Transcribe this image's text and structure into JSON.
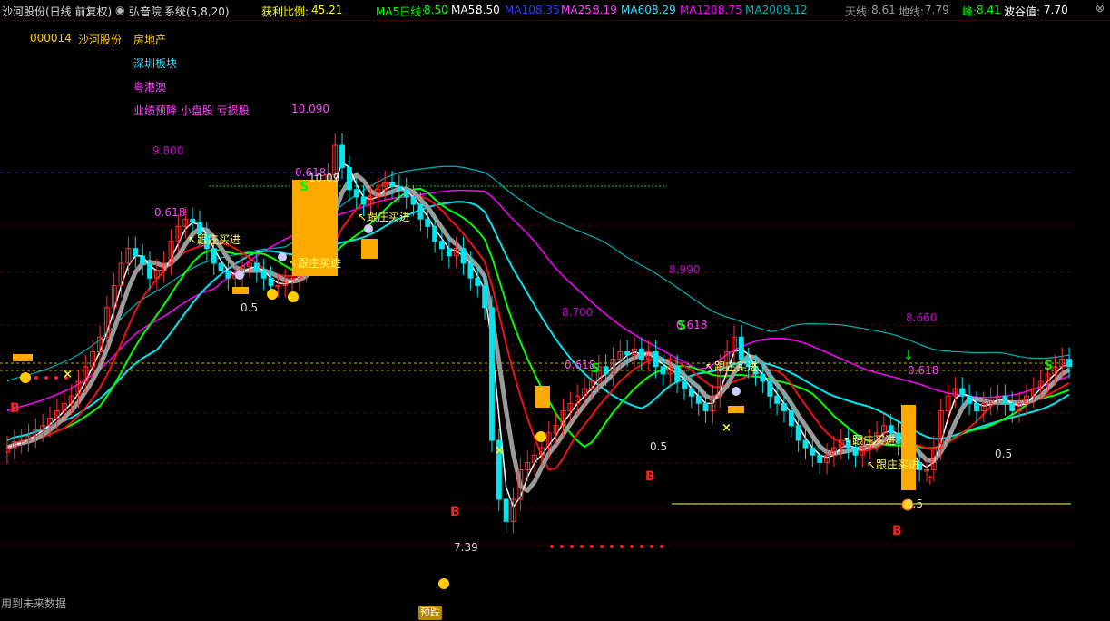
{
  "header": {
    "title": "沙河股份(日线 前复权)",
    "indicator_label": "弘音院",
    "system": "系统(5,8,20)",
    "profit_ratio_label": "获利比例:",
    "profit_ratio_value": "45.21",
    "ma5_day_label": "MA5日线:",
    "ma5_day_value": "8.50",
    "ma5_label": "MA5:",
    "ma5_value": "8.50",
    "ma10_label": "MA10:",
    "ma10_value": "8.35",
    "ma25_label": "MA25:",
    "ma25_value": "8.19",
    "ma60_label": "MA60:",
    "ma60_value": "8.29",
    "ma120_label": "MA120:",
    "ma120_value": "8.75",
    "ma200_label": "MA200:",
    "ma200_value": "9.12",
    "sky_label": "天线:",
    "sky_value": "8.61",
    "ground_label": "地线:",
    "ground_value": "7.79",
    "peak_label": "峰:",
    "peak_value": "8.41",
    "wave_label": "波谷值:",
    "wave_value": "7.70"
  },
  "info": {
    "code": "000014",
    "name": "沙河股份",
    "industry": "房地产",
    "board": "深圳板块",
    "concept": "粤港澳",
    "tags": "业绩预降 小盘股 亏损股",
    "price_level": "10.090"
  },
  "footer": {
    "future_data_note": "用到未来数据",
    "predict_drop": "预跌"
  },
  "colors": {
    "up": "#ff3030",
    "down": "#00e5ee",
    "ma5": "#ffffff",
    "ma10": "#1a3cff",
    "ma25": "#ff40ff",
    "ma60": "#00ff00",
    "ma120": "#ff00ff",
    "ma200": "#00b3b3"
  },
  "chart_data": {
    "type": "candlestick",
    "ylim": [
      7.2,
      10.4
    ],
    "level_labels": [
      {
        "text": "9.800",
        "price": 9.8,
        "color": "#cc00cc"
      },
      {
        "text": "8.990",
        "price": 9.0,
        "color": "#cc00cc"
      },
      {
        "text": "8.700",
        "price": 8.7,
        "color": "#cc00cc"
      },
      {
        "text": "8.660",
        "price": 8.66,
        "color": "#cc00cc"
      }
    ],
    "fib_labels": [
      {
        "text": "0.618",
        "color": "#ff44ff"
      },
      {
        "text": "0.618",
        "color": "#ff44ff"
      },
      {
        "text": "0.618",
        "color": "#ff44ff"
      },
      {
        "text": "0.618",
        "color": "#ff44ff"
      },
      {
        "text": "0.618",
        "color": "#ff44ff"
      },
      {
        "text": "0.5",
        "color": "#dddddd"
      },
      {
        "text": "0.5",
        "color": "#dddddd"
      },
      {
        "text": "0.5",
        "color": "#dddddd"
      },
      {
        "text": "0.5",
        "color": "#dddddd"
      }
    ],
    "point_labels": [
      {
        "text": "10.09",
        "color": "#dddddd"
      },
      {
        "text": "7.39",
        "color": "#dddddd"
      }
    ],
    "annotations": [
      {
        "text": "跟庄买进",
        "color": "#ffff66"
      },
      {
        "text": "跟庄买进",
        "color": "#ffff66"
      },
      {
        "text": "跟庄买进",
        "color": "#ffff66"
      },
      {
        "text": "跟庄买进",
        "color": "#ffff66"
      },
      {
        "text": "跟庄买进",
        "color": "#ffff66"
      },
      {
        "text": "跟庄买进",
        "color": "#ffff66"
      }
    ],
    "signals_b": [
      "B",
      "B",
      "B",
      "B"
    ],
    "signals_s": [
      "S",
      "S",
      "S",
      "S"
    ],
    "series_close": [
      7.95,
      7.99,
      8.0,
      8.03,
      8.07,
      8.1,
      8.15,
      8.2,
      8.25,
      8.3,
      8.4,
      8.5,
      8.6,
      8.7,
      8.9,
      9.05,
      9.2,
      9.3,
      9.25,
      9.2,
      9.1,
      9.15,
      9.2,
      9.35,
      9.45,
      9.5,
      9.48,
      9.4,
      9.3,
      9.2,
      9.15,
      9.1,
      9.12,
      9.18,
      9.2,
      9.15,
      9.1,
      9.05,
      9.05,
      9.08,
      9.1,
      9.15,
      9.2,
      9.3,
      9.45,
      9.8,
      10.0,
      9.85,
      9.7,
      9.65,
      9.6,
      9.65,
      9.7,
      9.75,
      9.72,
      9.7,
      9.65,
      9.6,
      9.5,
      9.45,
      9.35,
      9.3,
      9.25,
      9.3,
      9.2,
      9.1,
      9.05,
      8.9,
      8.0,
      7.6,
      7.45,
      7.6,
      7.8,
      7.85,
      7.9,
      7.95,
      8.05,
      8.1,
      8.2,
      8.25,
      8.3,
      8.35,
      8.4,
      8.5,
      8.45,
      8.55,
      8.6,
      8.58,
      8.62,
      8.55,
      8.6,
      8.5,
      8.45,
      8.5,
      8.4,
      8.35,
      8.3,
      8.25,
      8.2,
      8.3,
      8.5,
      8.6,
      8.7,
      8.55,
      8.5,
      8.45,
      8.4,
      8.3,
      8.25,
      8.2,
      8.1,
      8.0,
      7.95,
      7.9,
      7.85,
      7.9,
      7.95,
      8.0,
      7.95,
      7.9,
      7.95,
      8.0,
      8.05,
      8.1,
      8.05,
      7.98,
      7.9,
      7.85,
      7.8,
      7.8,
      7.95,
      8.2,
      8.3,
      8.35,
      8.3,
      8.25,
      8.2,
      8.25,
      8.28,
      8.3,
      8.25,
      8.2,
      8.25,
      8.3,
      8.35,
      8.4,
      8.45,
      8.5,
      8.55,
      8.5
    ]
  }
}
